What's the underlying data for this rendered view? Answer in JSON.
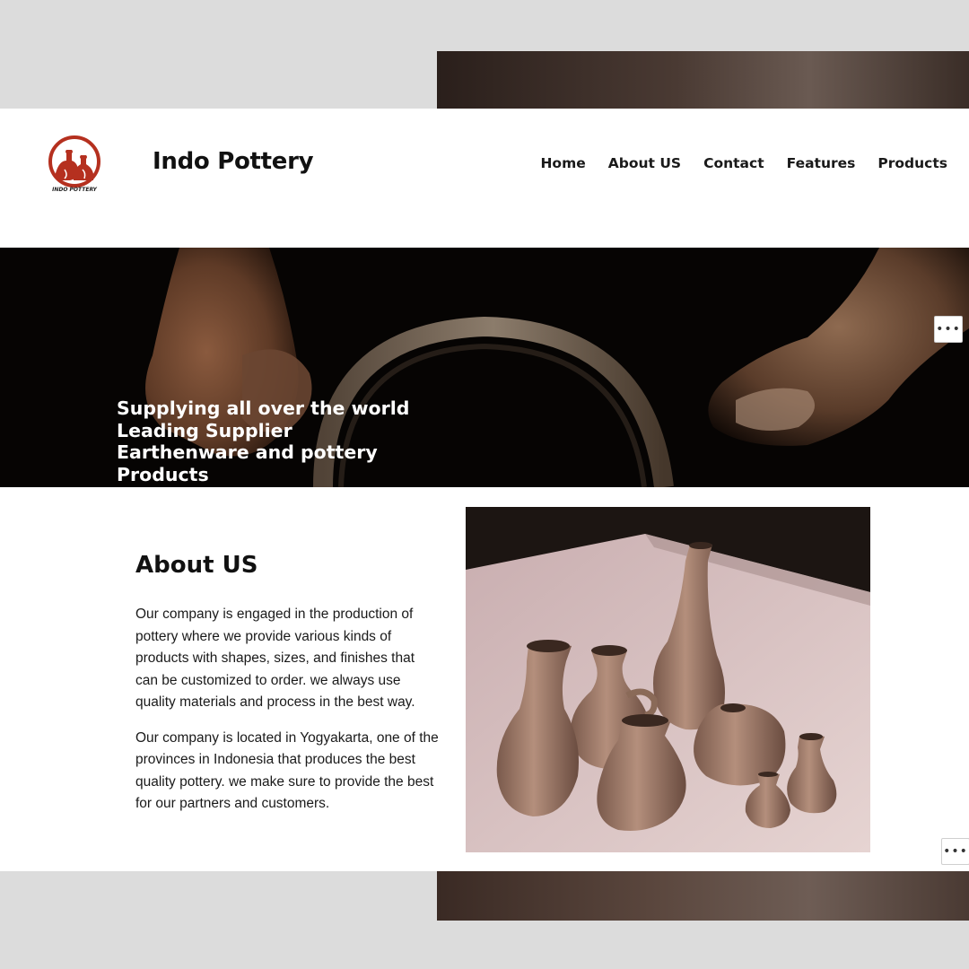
{
  "site": {
    "title": "Indo Pottery",
    "logo_text": "INDO POTTERY"
  },
  "nav": {
    "items": [
      "Home",
      "About US",
      "Contact",
      "Features",
      "Products"
    ]
  },
  "hero": {
    "lines": [
      "Supplying all over the world",
      "Leading Supplier",
      "Earthenware and pottery",
      "Products"
    ],
    "more_label": "•••"
  },
  "about": {
    "title": "About US",
    "paragraphs": [
      "Our company is engaged in the production of pottery where we provide various kinds of products with shapes, sizes, and finishes that can be customized to order. we always use quality materials and process in the best way.",
      "Our company is located in Yogyakarta, one of the provinces in Indonesia that produces the best quality pottery. we make sure to provide the best for our partners and customers."
    ]
  },
  "side_more_label": "•••",
  "colors": {
    "brand_red": "#b5301f",
    "page_bg": "#dcdcdc",
    "text": "#111111"
  }
}
